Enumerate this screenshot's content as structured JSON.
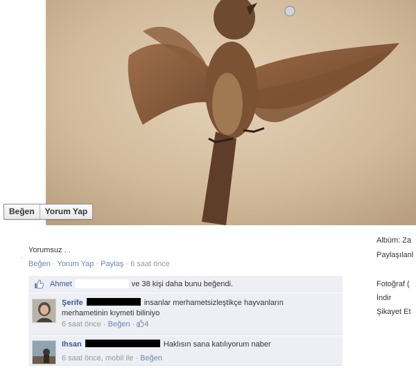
{
  "photo": {
    "alt": "bird in flight",
    "actions": {
      "like_label": "Beğen",
      "comment_label": "Yorum Yap"
    }
  },
  "post": {
    "caption": "Yorumsuz . .",
    "bullet": "·",
    "actions": {
      "like_label": "Beğen",
      "comment_label": "Yorum Yap",
      "share_label": "Paylaş",
      "separator": "·",
      "timestamp": "6 saat önce"
    }
  },
  "likes": {
    "icon": "thumbs-up-icon",
    "first_name": "Ahmet",
    "rest": "ve 38 kişi daha bunu beğendi."
  },
  "comments": [
    {
      "author": "Şerife",
      "text_line1": "insanlar merhametsizleştikçe hayvanların",
      "text_line2": "merhametinin kıymeti biliniyo",
      "timestamp": "6 saat önce",
      "separator": "·",
      "like_label": "Beğen",
      "like_count": "4"
    },
    {
      "author": "Ihsan",
      "text_line1": "Haklısın sana katılıyorum naber",
      "timestamp": "6 saat önce, mobil ile",
      "separator": "·",
      "like_label": "Beğen"
    }
  ],
  "sidebar": {
    "album_label": "Albüm: Za",
    "shared_label": "Paylaşılanl",
    "tag_photo_label": "Fotoğraf (",
    "download_label": "İndir",
    "report_label": "Şikayet Et"
  }
}
